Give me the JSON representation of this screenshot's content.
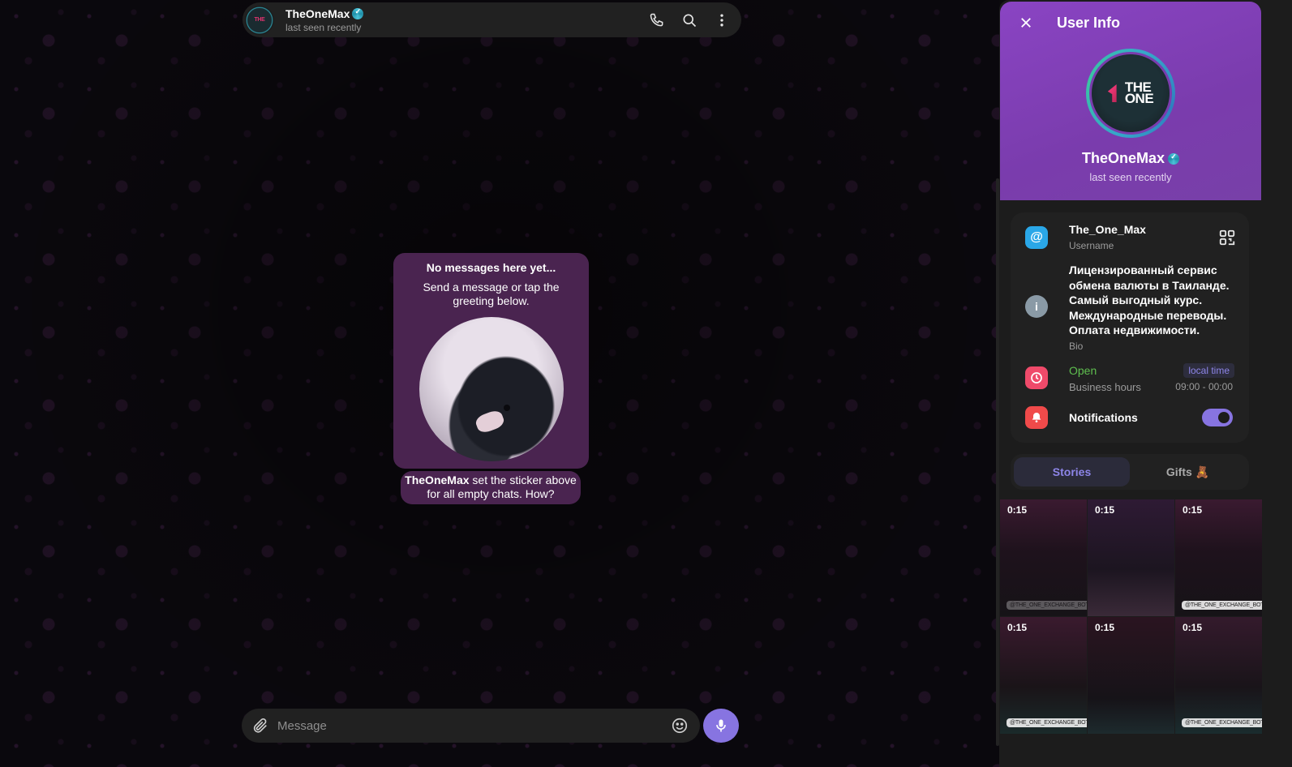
{
  "header": {
    "name": "TheOneMax",
    "status": "last seen recently",
    "avatar_text_a": "THE",
    "avatar_text_b": "ONE"
  },
  "empty_chat": {
    "title": "No messages here yet...",
    "subtitle": "Send a message or tap the greeting below.",
    "note_name": "TheOneMax",
    "note_text": " set the sticker above for all empty chats. How?"
  },
  "composer": {
    "placeholder": "Message"
  },
  "panel": {
    "title": "User Info",
    "name": "TheOneMax",
    "status": "last seen recently",
    "logo_line1": "THE",
    "logo_line2": "ONE",
    "username": "The_One_Max",
    "username_label": "Username",
    "bio": "Лицензированный сервис обмена валюты в Таиланде. Самый выгодный курс. Международные переводы. Оплата недвижимости.",
    "bio_label": "Bio",
    "hours_status": "Open",
    "hours_label": "Business hours",
    "local_time": "local time",
    "hours_value": "09:00 - 00:00",
    "notifications": "Notifications",
    "notifications_on": true,
    "tabs": [
      {
        "label": "Stories",
        "active": true
      },
      {
        "label": "Gifts 🧸",
        "active": false
      }
    ],
    "stories": [
      {
        "duration": "0:15",
        "tag": "@THE_ONE_EXCHANGE_BOT"
      },
      {
        "duration": "0:15",
        "tag": ""
      },
      {
        "duration": "0:15",
        "tag": "@THE_ONE_EXCHANGE_BOT"
      },
      {
        "duration": "0:15",
        "tag": "@THE_ONE_EXCHANGE_BOT"
      },
      {
        "duration": "0:15",
        "tag": ""
      },
      {
        "duration": "0:15",
        "tag": "@THE_ONE_EXCHANGE_BOT"
      }
    ]
  },
  "colors": {
    "accent": "#8774e1",
    "panel_header": "#7a3cad",
    "bubble": "#4a2450",
    "username_icon": "#2aa7e8",
    "bio_icon": "#8a9aa6",
    "hours_icon": "#ef4a6a",
    "notif_icon": "#f04a4a",
    "open_green": "#5fbf4f"
  }
}
